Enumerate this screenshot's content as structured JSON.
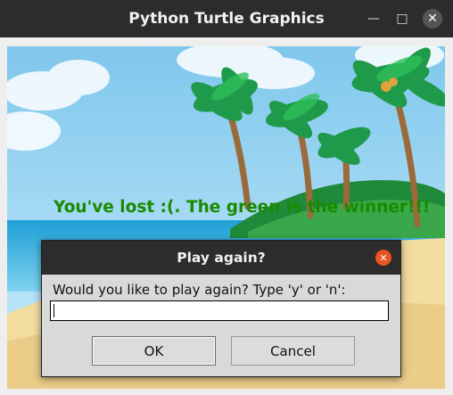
{
  "window": {
    "title": "Python Turtle Graphics"
  },
  "canvas": {
    "message": "You've lost :(. The green is the winner!!!"
  },
  "dialog": {
    "title": "Play again?",
    "prompt": "Would you like to play again? Type 'y' or 'n':",
    "input_value": "",
    "ok_label": "OK",
    "cancel_label": "Cancel"
  },
  "colors": {
    "message": "#1a8a00",
    "dialog_close": "#e95420",
    "titlebar": "#2c2c2c"
  }
}
